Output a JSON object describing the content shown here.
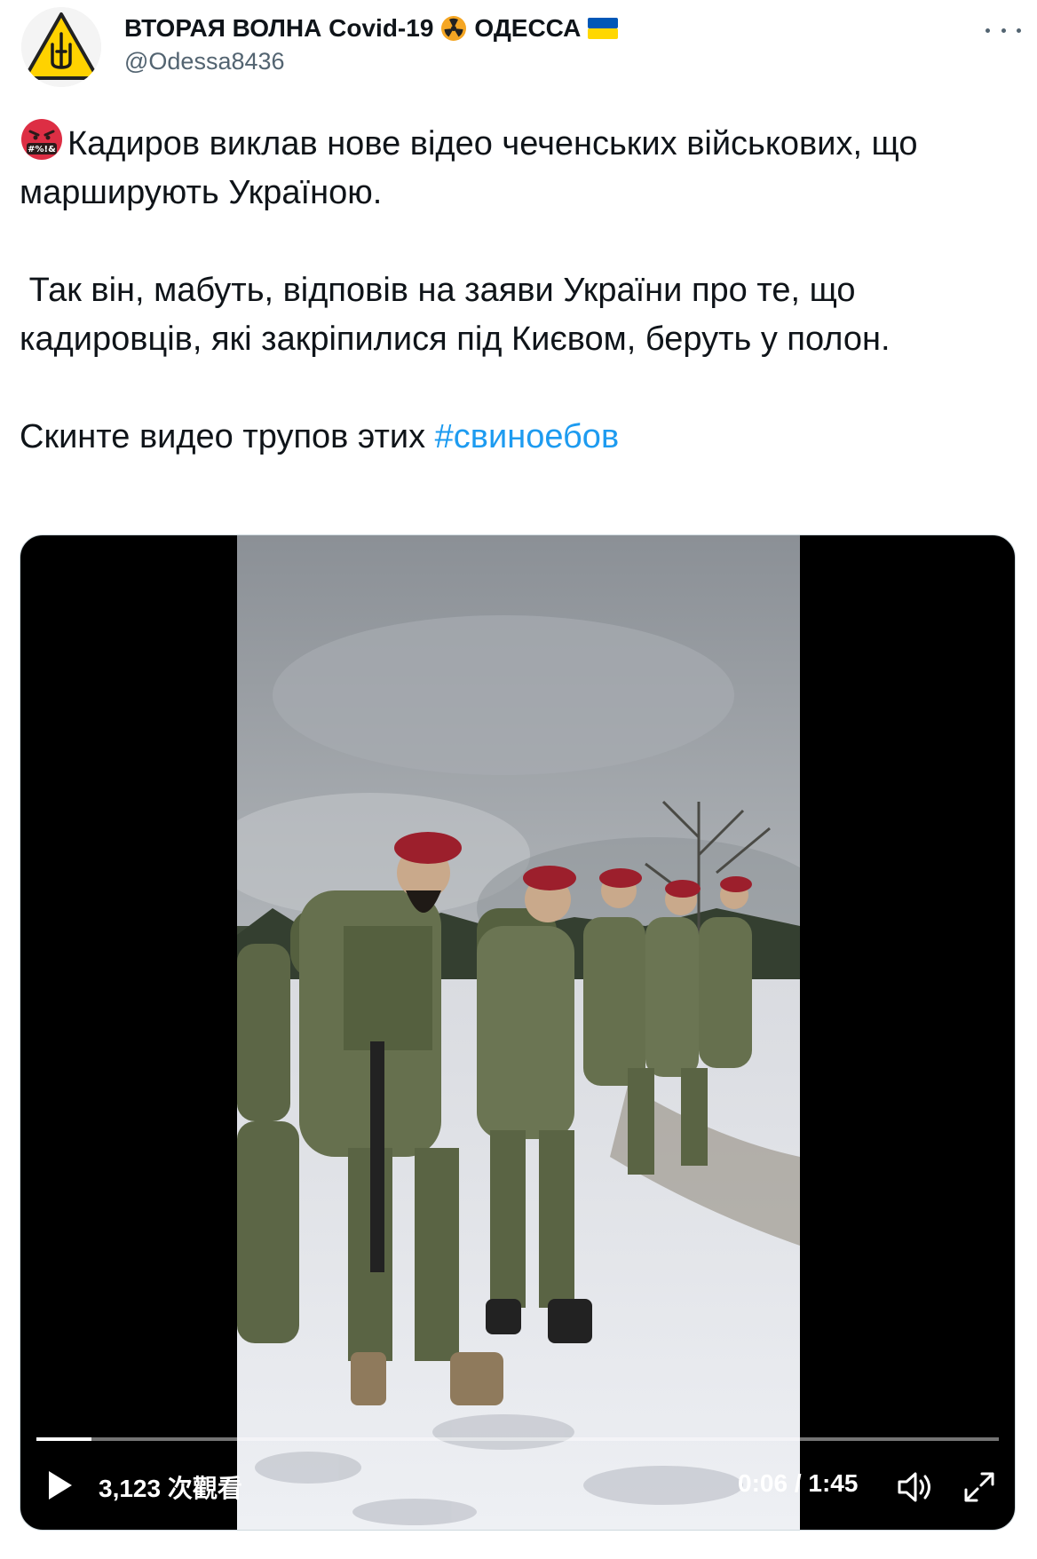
{
  "author": {
    "display_name_part1": "ВТОРАЯ ВОЛНА Covid-19",
    "display_name_part2": "ОДЕССА",
    "handle": "@Odessa8436",
    "avatar_icon": "warning-triangle-trident-icon",
    "name_icons": [
      "radioactive-icon",
      "ukraine-flag-icon"
    ]
  },
  "menu": {
    "more_icon": "more-dots-icon"
  },
  "tweet": {
    "emoji": "angry-face-symbols-icon",
    "paragraph1": "Кадиров виклав нове відео чеченських військових, що марширують Україною.",
    "paragraph2": " Так він, мабуть, відповів на заяви України про те, що кадировців, які закріпилися під Києвом, беруть у полон.",
    "paragraph3_text": "Скинте видео трупов этих ",
    "hashtag": "#свиноебов"
  },
  "video": {
    "views": "3,123 次觀看",
    "time": "0:06 / 1:45",
    "progress": 0.057,
    "play_icon": "play-icon",
    "volume_icon": "volume-icon",
    "fullscreen_icon": "fullscreen-icon"
  },
  "colors": {
    "text": "#0f1419",
    "secondary": "#536471",
    "link": "#1d9bf0",
    "flag_blue": "#0057b7",
    "flag_yellow": "#ffd700",
    "radioactive": "#f5a623"
  }
}
